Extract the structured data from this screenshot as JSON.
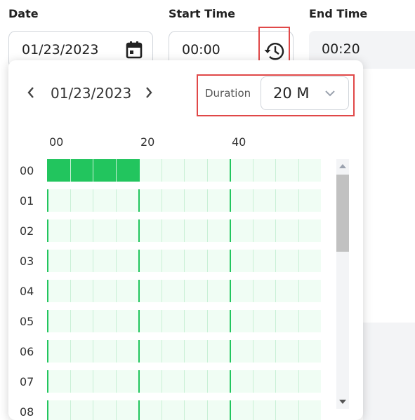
{
  "labels": {
    "date": "Date",
    "start": "Start Time",
    "end": "End Time"
  },
  "fields": {
    "date": "01/23/2023",
    "start": "00:00",
    "end": "00:20"
  },
  "picker": {
    "date": "01/23/2023",
    "duration_label": "Duration",
    "duration_value": "20 M",
    "minute_headers": [
      "00",
      "20",
      "40"
    ],
    "hours": [
      "00",
      "01",
      "02",
      "03",
      "04",
      "05",
      "06",
      "07",
      "08"
    ],
    "selected_hour": "00",
    "selected_minutes_count": 4
  },
  "colors": {
    "accent": "#22c55e",
    "highlight": "#e04848",
    "cell": "#f0fdf4"
  },
  "icons": [
    "calendar-icon",
    "history-icon",
    "chevron-left-icon",
    "chevron-right-icon",
    "chevron-down-icon"
  ]
}
